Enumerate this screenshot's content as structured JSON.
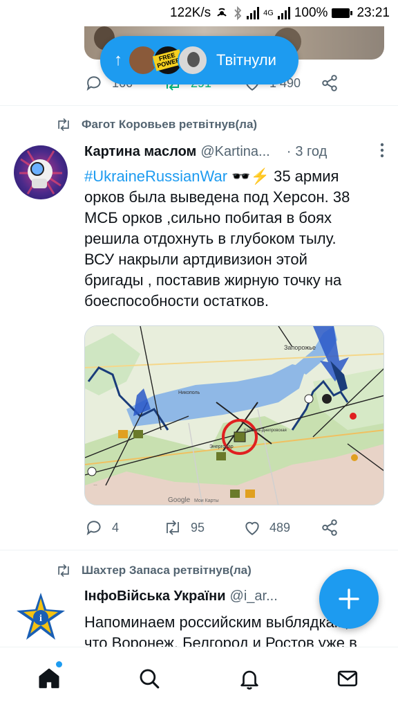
{
  "status_bar": {
    "speed": "122K/s",
    "network": "4G",
    "battery": "100%",
    "time": "23:21"
  },
  "top_tweet": {
    "pill_label": "Твітнули",
    "pill_avatar_text": "FREE POWER",
    "replies": "166",
    "retweets": "291",
    "likes": "1 490"
  },
  "tweet1": {
    "retweeted_by": "Фагот Коровьев ретвітнув(ла)",
    "name": "Картина маслом",
    "handle": "@Kartina...",
    "dot": "·",
    "time": "3 год",
    "hashtag": "#UkraineRussianWar",
    "emoji": "🕶️⚡",
    "text_lines": [
      "35 армия",
      "орков была выведена под Херсон. 38",
      "МСБ орков ,сильно побитая в боях",
      "решила отдохнуть в глубоком тылу.",
      "ВСУ накрыли артдивизион этой",
      "бригады , поставив жирную точку на",
      "боеспособности остатков."
    ],
    "replies": "4",
    "retweets": "95",
    "likes": "489",
    "map_labels": {
      "zaporozhye": "Запорожье",
      "nikopol": "Никополь",
      "energodar": "Энергодар",
      "kamenka": "Каменка-Днепровская",
      "google": "Google",
      "map_data": "Мои Карты"
    }
  },
  "tweet2": {
    "retweeted_by": "Шахтер Запаса ретвітнув(ла)",
    "name": "ІнфоВійська України",
    "handle": "@i_ar...",
    "text_line1": "Напоминаем российским выблядкам,",
    "text_line2": "что Воронеж, Белгород и Ростов уже в"
  },
  "colors": {
    "accent": "#1d9bf0",
    "text_secondary": "#536471"
  }
}
